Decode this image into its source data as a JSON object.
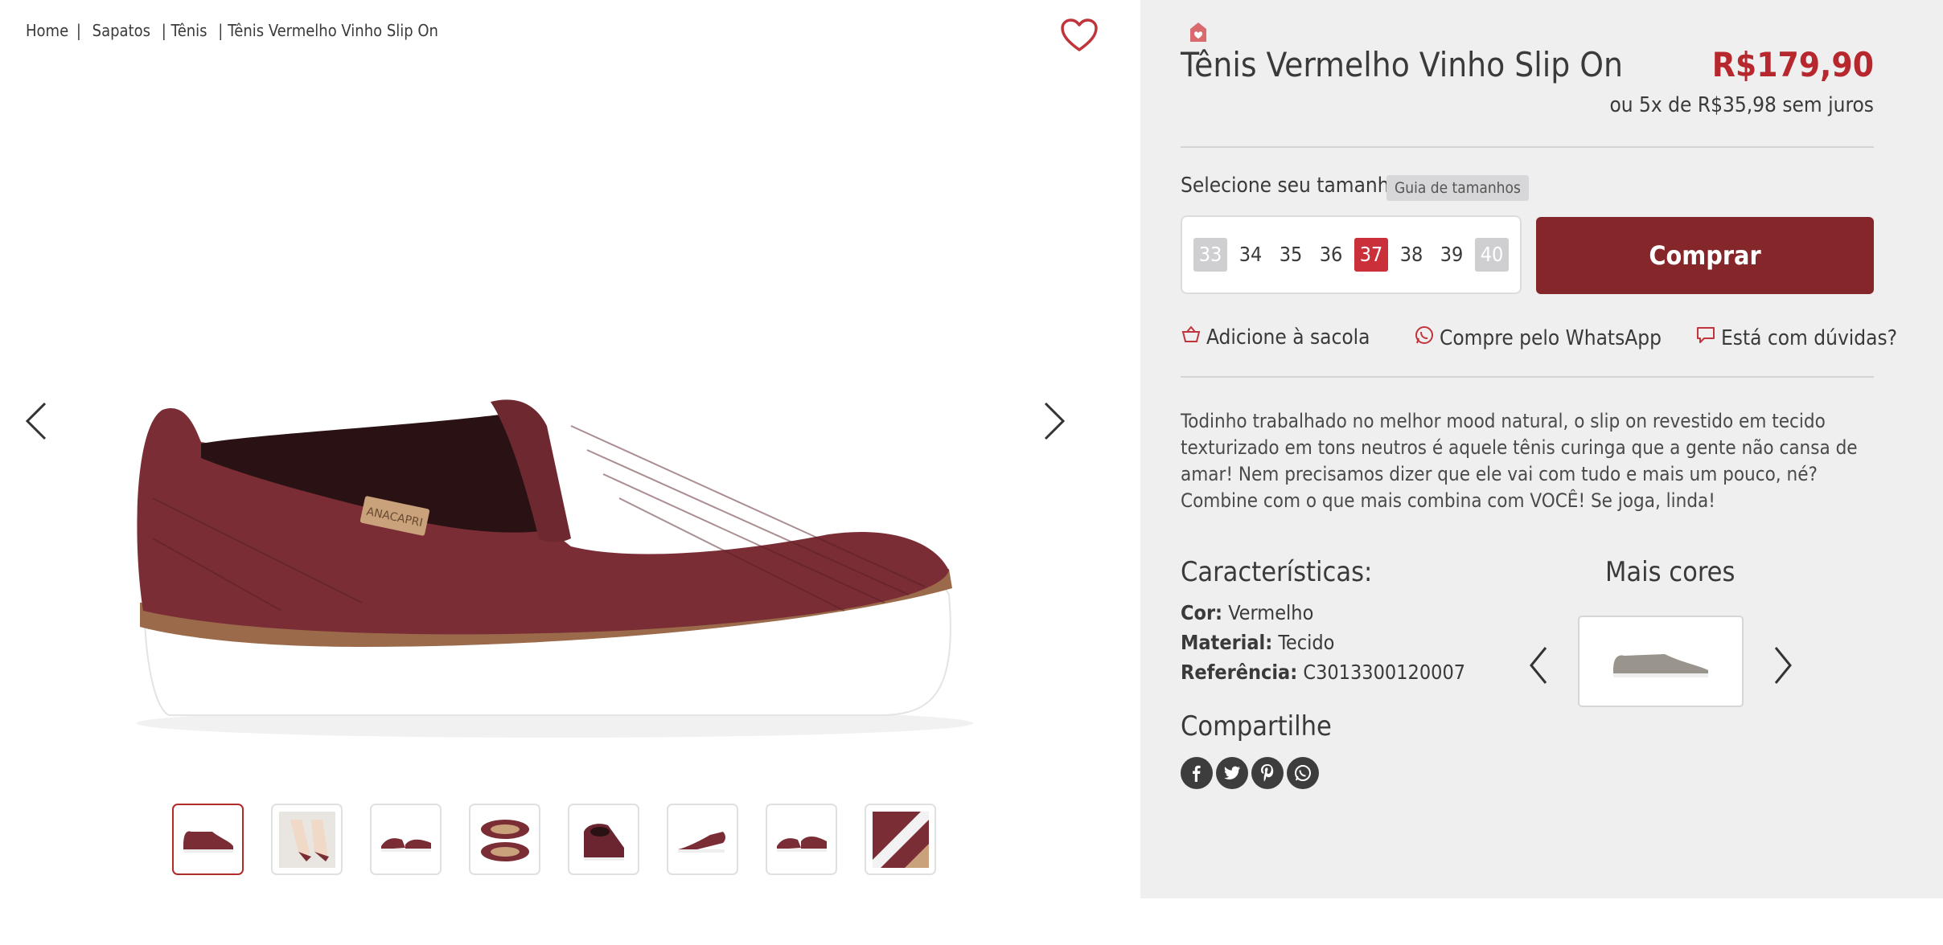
{
  "breadcrumb": {
    "home": "Home",
    "sep1": "|",
    "sapatos": "Sapatos",
    "sep2": "|",
    "tenis": "Tênis",
    "sep3": "|",
    "current": "Tênis Vermelho Vinho Slip On"
  },
  "gallery": {
    "thumbnails": [
      {
        "name": "thumb-1",
        "active": true
      },
      {
        "name": "thumb-2",
        "active": false
      },
      {
        "name": "thumb-3",
        "active": false
      },
      {
        "name": "thumb-4",
        "active": false
      },
      {
        "name": "thumb-5",
        "active": false
      },
      {
        "name": "thumb-6",
        "active": false
      },
      {
        "name": "thumb-7",
        "active": false
      },
      {
        "name": "thumb-8",
        "active": false
      }
    ],
    "shoe_label": "ANACAPRI"
  },
  "product": {
    "title": "Tênis Vermelho Vinho Slip On",
    "price": "R$179,90",
    "installments": "ou 5x de R$35,98 sem juros"
  },
  "size": {
    "label": "Selecione seu tamanho",
    "guide": "Guia de tamanhos",
    "options": [
      {
        "value": "33",
        "state": "unavailable"
      },
      {
        "value": "34",
        "state": "available"
      },
      {
        "value": "35",
        "state": "available"
      },
      {
        "value": "36",
        "state": "available"
      },
      {
        "value": "37",
        "state": "selected"
      },
      {
        "value": "38",
        "state": "available"
      },
      {
        "value": "39",
        "state": "available"
      },
      {
        "value": "40",
        "state": "unavailable"
      }
    ]
  },
  "buy_label": "Comprar",
  "actions": {
    "bag": "Adicione à sacola",
    "whatsapp": "Compre pelo WhatsApp",
    "questions": "Está com dúvidas?"
  },
  "description": "Todinho trabalhado no melhor mood natural, o slip on revestido em tecido texturizado em tons neutros é aquele tênis curinga que a gente não cansa de amar! Nem precisamos dizer que ele vai com tudo e mais um pouco, né? Combine com o que mais combina com VOCÊ! Se joga, linda!",
  "characteristics": {
    "heading": "Características:",
    "cor_label": "Cor:",
    "cor_value": "Vermelho",
    "material_label": "Material:",
    "material_value": "Tecido",
    "ref_label": "Referência:",
    "ref_value": "C3013300120007"
  },
  "more_colors": {
    "heading": "Mais cores"
  },
  "share": {
    "heading": "Compartilhe",
    "networks": [
      "facebook-icon",
      "twitter-icon",
      "pinterest-icon",
      "whatsapp-icon"
    ]
  },
  "colors": {
    "brand_red": "#b7282e",
    "buy_bg": "#84262a",
    "selected_size": "#c9303a",
    "panel_bg": "#efeff0"
  }
}
